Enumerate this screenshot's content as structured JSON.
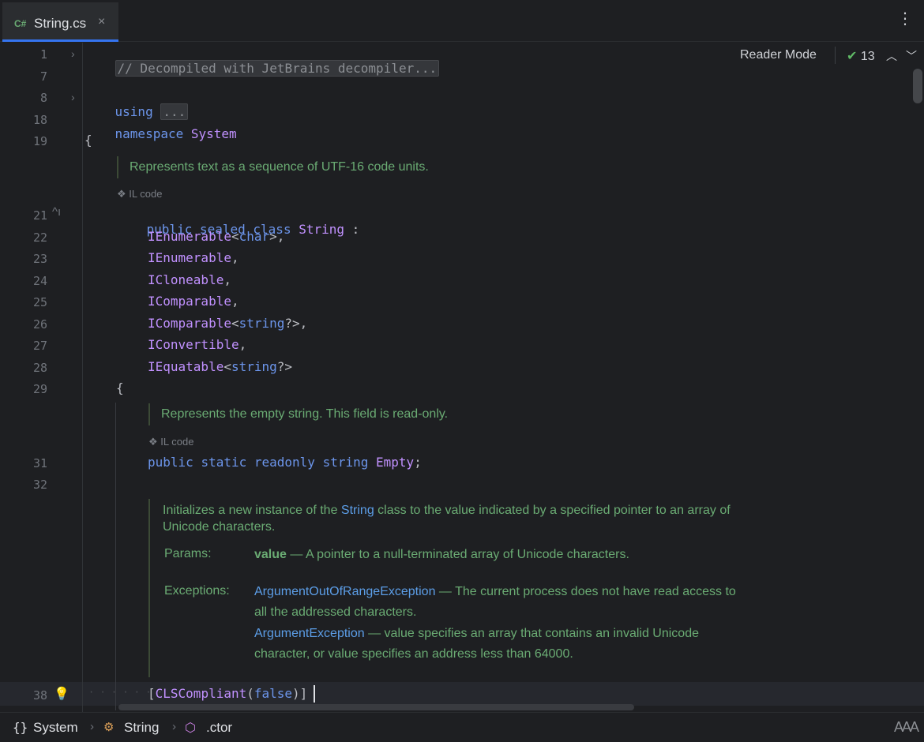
{
  "tab": {
    "lang": "C#",
    "title": "String.cs",
    "close": "×"
  },
  "toolbar": {
    "reader_mode": "Reader Mode",
    "inspections_count": "13",
    "check": "✔"
  },
  "line_numbers": [
    "1",
    "7",
    "8",
    "18",
    "19",
    "21",
    "22",
    "23",
    "24",
    "25",
    "26",
    "27",
    "28",
    "29",
    "31",
    "32",
    "38"
  ],
  "code": {
    "l1": "// Decompiled with JetBrains decompiler...",
    "l8_kw": "using",
    "l8_fold": "...",
    "l18_kw": "namespace",
    "l18_name": "System",
    "l19": "{",
    "l21_public": "public",
    "l21_sealed": "sealed",
    "l21_class": "class",
    "l21_name": "String",
    "l21_colon": ":",
    "l22": [
      "IEnumerable",
      "<",
      "char",
      ">,"
    ],
    "l23": [
      "IEnumerable",
      ","
    ],
    "l24": [
      "ICloneable",
      ","
    ],
    "l25": [
      "IComparable",
      ","
    ],
    "l26": [
      "IComparable",
      "<",
      "string",
      "?>,"
    ],
    "l27": [
      "IConvertible",
      ","
    ],
    "l28": [
      "IEquatable",
      "<",
      "string",
      "?>"
    ],
    "l29": "{",
    "l31": [
      "public",
      "static",
      "readonly",
      "string",
      "Empty",
      ";"
    ],
    "l38": [
      "[",
      "CLSCompliant",
      "(",
      "false",
      ")]"
    ]
  },
  "docs": {
    "class_summary": "Represents text as a sequence of UTF-16 code units.",
    "il_code": "IL code",
    "empty_summary": "Represents the empty string. This field is read-only.",
    "ctor_summary_pre": "Initializes a new instance of the",
    "ctor_summary_ref": "String",
    "ctor_summary_post": "class to the value indicated by a specified pointer to an array of Unicode characters.",
    "params_label": "Params:",
    "param_name": "value",
    "param_desc": "— A pointer to a null-terminated array of Unicode characters.",
    "exceptions_label": "Exceptions:",
    "ex1_name": "ArgumentOutOfRangeException",
    "ex1_desc": "— The current process does not have read access to all the addressed characters.",
    "ex2_name": "ArgumentException",
    "ex2_desc": "— value specifies an array that contains an invalid Unicode character, or value specifies an address less than 64000."
  },
  "statusbar": {
    "crumbs": [
      "System",
      "String",
      ".ctor"
    ],
    "icons": [
      "{}",
      "class-icon",
      "method-icon"
    ],
    "font_icon": "AAA"
  }
}
